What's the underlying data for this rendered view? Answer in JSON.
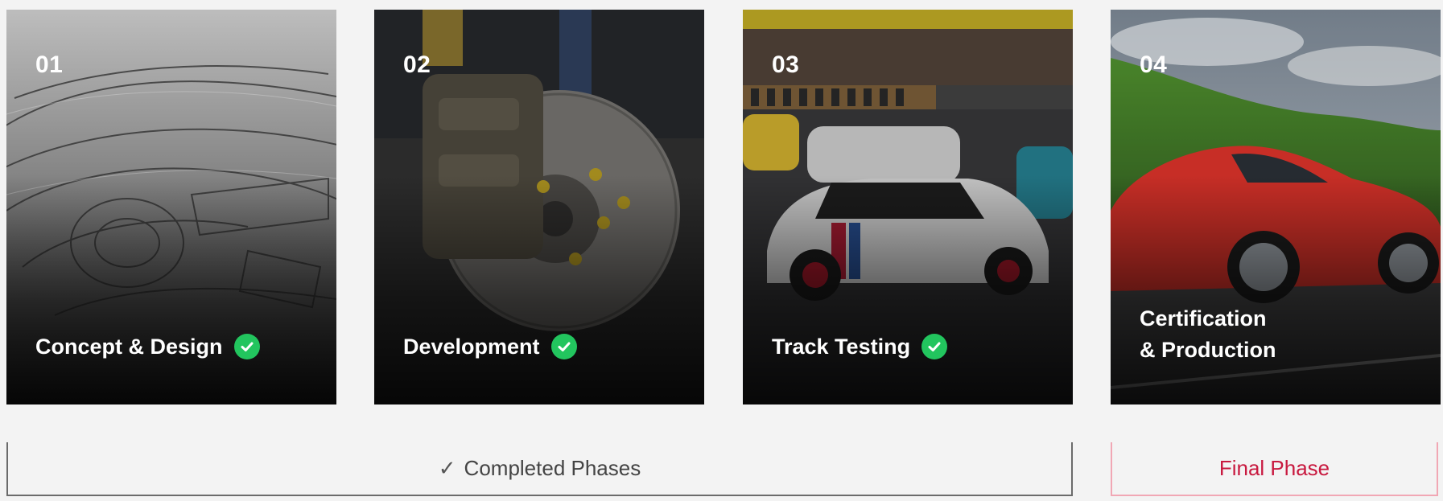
{
  "cards": [
    {
      "number": "01",
      "title": "Concept & Design",
      "completed": true
    },
    {
      "number": "02",
      "title": "Development",
      "completed": true
    },
    {
      "number": "03",
      "title": "Track Testing",
      "completed": true
    },
    {
      "number": "04",
      "title_line1": "Certification",
      "title_line2": "& Production",
      "completed": false
    }
  ],
  "groups": {
    "completed_label": "Completed Phases",
    "completed_tick": "✓",
    "final_label": "Final Phase"
  },
  "colors": {
    "background": "#f3f3f3",
    "check": "#22c55e",
    "final_accent": "#c8193f",
    "final_border": "#f1a7b4",
    "completed_border": "#6b6b6b"
  },
  "icons": [
    "check-circle-icon"
  ]
}
